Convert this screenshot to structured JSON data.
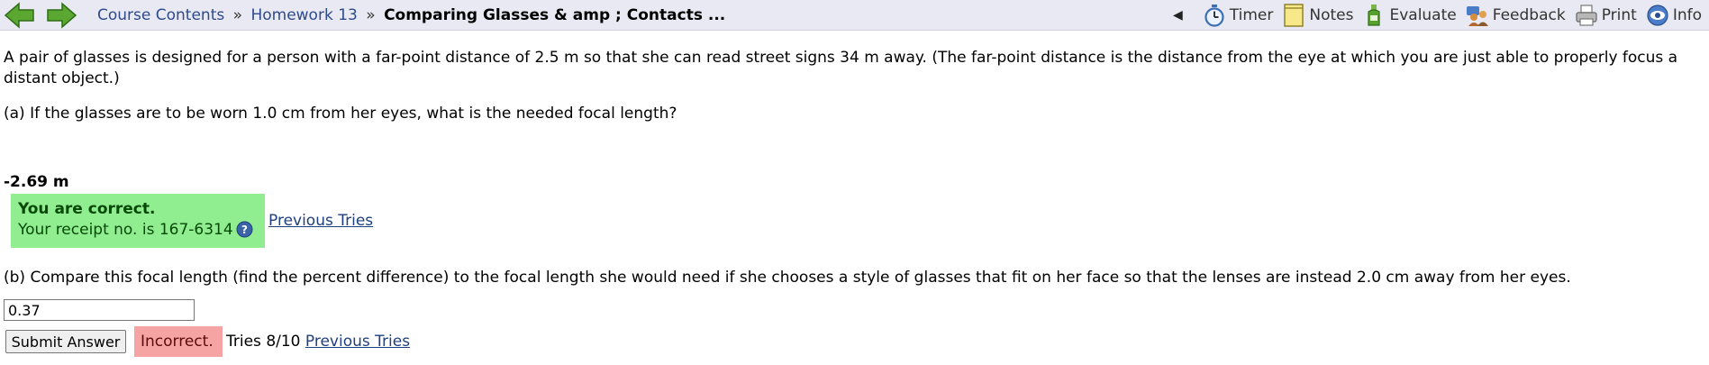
{
  "nav": {
    "back_icon": "back-arrow-icon",
    "forward_icon": "forward-arrow-icon",
    "breadcrumb": {
      "course": "Course Contents",
      "separator1": "»",
      "homework": "Homework 13",
      "separator2": "»",
      "current": "Comparing Glasses & amp ; Contacts ..."
    },
    "tools": {
      "collapse_glyph": "◀",
      "timer": "Timer",
      "notes": "Notes",
      "evaluate": "Evaluate",
      "feedback": "Feedback",
      "print": "Print",
      "info": "Info"
    }
  },
  "problem": {
    "intro": "A pair of glasses is designed for a person with a far-point distance of 2.5 m so that she can read street signs 34 m away. (The far-point distance is the distance from the eye at which you are just able to properly focus a distant object.)",
    "part_a": {
      "question": "(a) If the glasses are to be worn 1.0 cm from her eyes, what is the needed focal length?",
      "answer": "-2.69 m",
      "status_line1": "You are correct.",
      "status_line2": "Your receipt no. is 167-6314",
      "previous_tries": "Previous Tries"
    },
    "part_b": {
      "question": "(b) Compare this focal length (find the percent difference) to the focal length she would need if she chooses a style of glasses that fit on her face so that the lenses are instead 2.0 cm away from her eyes.",
      "input_value": "0.37",
      "submit_label": "Submit Answer",
      "status": "Incorrect.",
      "tries": "Tries 8/10",
      "previous_tries": "Previous Tries"
    }
  },
  "colors": {
    "nav_bg": "#e9e9f3",
    "arrow_green": "#5aa832",
    "correct_bg": "#90ee90",
    "incorrect_bg": "#f5a3a3",
    "link": "#1f3f7f"
  }
}
